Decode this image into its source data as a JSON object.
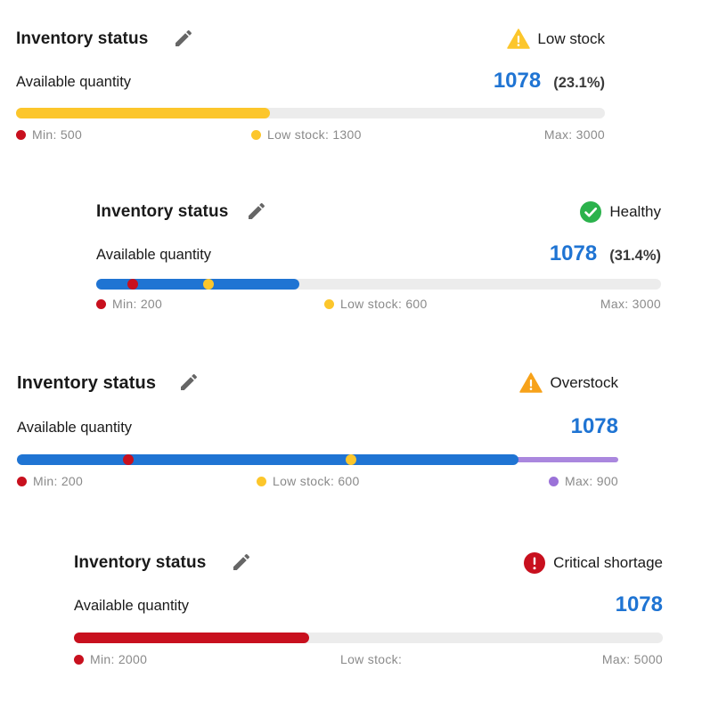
{
  "colors": {
    "blue": "#1f74d3",
    "yellow": "#fcc62b",
    "red": "#c8101e",
    "purple": "#9b72d8",
    "green": "#2bb24c",
    "orange": "#f7a21a",
    "track": "#ececec"
  },
  "cards": [
    {
      "title": "Inventory status",
      "status_label": "Low stock",
      "status_icon": "warning-yellow-icon",
      "available_label": "Available quantity",
      "quantity": "1078",
      "percent": "(23.1%)",
      "fill_fraction": 0.431,
      "fill_color": "yellow",
      "legend_min": "Min: 500",
      "legend_low": "Low stock: 1300",
      "legend_max": "Max: 3000"
    },
    {
      "title": "Inventory status",
      "status_label": "Healthy",
      "status_icon": "check-circle-icon",
      "available_label": "Available quantity",
      "quantity": "1078",
      "percent": "(31.4%)",
      "fill_fraction": 0.359,
      "fill_color": "blue",
      "marker_min_fraction": 0.065,
      "marker_low_fraction": 0.199,
      "legend_min": "Min: 200",
      "legend_low": "Low stock: 600",
      "legend_max": "Max: 3000"
    },
    {
      "title": "Inventory status",
      "status_label": "Overstock",
      "status_icon": "warning-orange-icon",
      "available_label": "Available quantity",
      "quantity": "1078",
      "fill_fraction": 0.834,
      "fill_color": "blue",
      "marker_min_fraction": 0.185,
      "marker_low_fraction": 0.556,
      "legend_min": "Min: 200",
      "legend_low": "Low stock: 600",
      "legend_max": "Max: 900"
    },
    {
      "title": "Inventory status",
      "status_label": "Critical shortage",
      "status_icon": "error-circle-icon",
      "available_label": "Available quantity",
      "quantity": "1078",
      "fill_fraction": 0.399,
      "fill_color": "red",
      "legend_min": "Min: 2000",
      "legend_low": "Low stock:",
      "legend_max": "Max: 5000"
    }
  ]
}
